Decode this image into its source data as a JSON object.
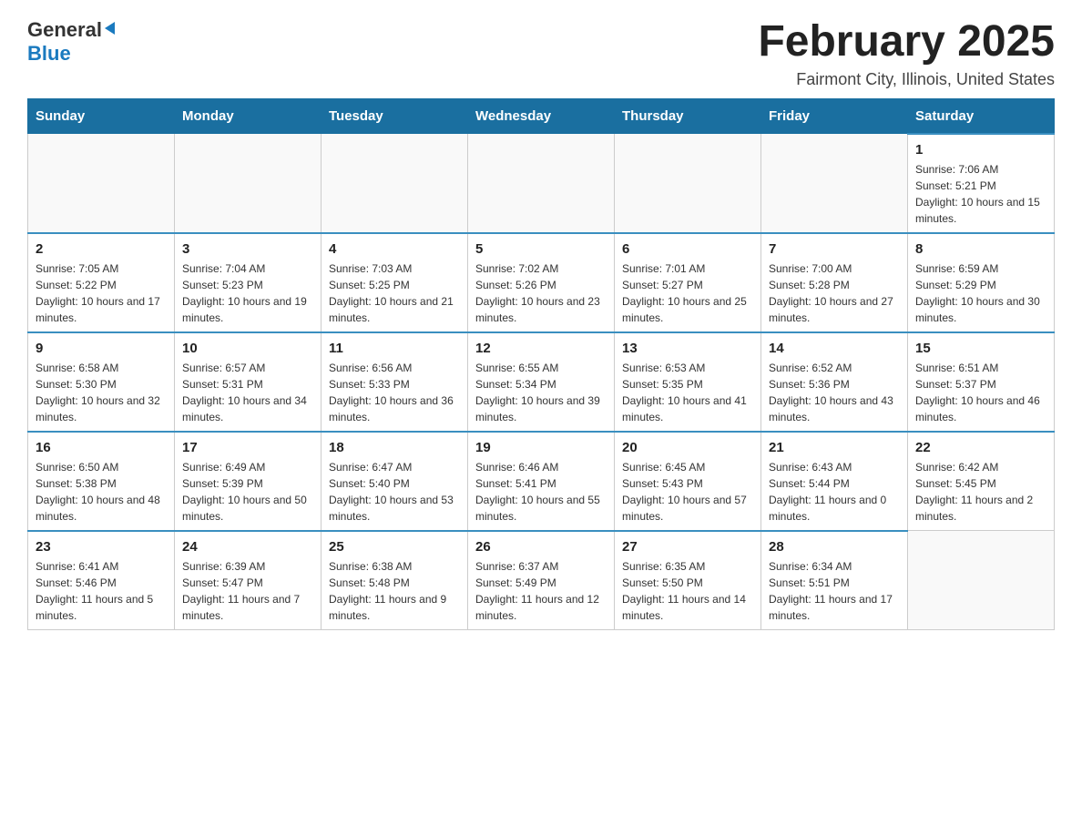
{
  "logo": {
    "general": "General",
    "blue": "Blue"
  },
  "title": {
    "month_year": "February 2025",
    "location": "Fairmont City, Illinois, United States"
  },
  "weekdays": [
    "Sunday",
    "Monday",
    "Tuesday",
    "Wednesday",
    "Thursday",
    "Friday",
    "Saturday"
  ],
  "weeks": [
    [
      {
        "day": "",
        "info": ""
      },
      {
        "day": "",
        "info": ""
      },
      {
        "day": "",
        "info": ""
      },
      {
        "day": "",
        "info": ""
      },
      {
        "day": "",
        "info": ""
      },
      {
        "day": "",
        "info": ""
      },
      {
        "day": "1",
        "info": "Sunrise: 7:06 AM\nSunset: 5:21 PM\nDaylight: 10 hours and 15 minutes."
      }
    ],
    [
      {
        "day": "2",
        "info": "Sunrise: 7:05 AM\nSunset: 5:22 PM\nDaylight: 10 hours and 17 minutes."
      },
      {
        "day": "3",
        "info": "Sunrise: 7:04 AM\nSunset: 5:23 PM\nDaylight: 10 hours and 19 minutes."
      },
      {
        "day": "4",
        "info": "Sunrise: 7:03 AM\nSunset: 5:25 PM\nDaylight: 10 hours and 21 minutes."
      },
      {
        "day": "5",
        "info": "Sunrise: 7:02 AM\nSunset: 5:26 PM\nDaylight: 10 hours and 23 minutes."
      },
      {
        "day": "6",
        "info": "Sunrise: 7:01 AM\nSunset: 5:27 PM\nDaylight: 10 hours and 25 minutes."
      },
      {
        "day": "7",
        "info": "Sunrise: 7:00 AM\nSunset: 5:28 PM\nDaylight: 10 hours and 27 minutes."
      },
      {
        "day": "8",
        "info": "Sunrise: 6:59 AM\nSunset: 5:29 PM\nDaylight: 10 hours and 30 minutes."
      }
    ],
    [
      {
        "day": "9",
        "info": "Sunrise: 6:58 AM\nSunset: 5:30 PM\nDaylight: 10 hours and 32 minutes."
      },
      {
        "day": "10",
        "info": "Sunrise: 6:57 AM\nSunset: 5:31 PM\nDaylight: 10 hours and 34 minutes."
      },
      {
        "day": "11",
        "info": "Sunrise: 6:56 AM\nSunset: 5:33 PM\nDaylight: 10 hours and 36 minutes."
      },
      {
        "day": "12",
        "info": "Sunrise: 6:55 AM\nSunset: 5:34 PM\nDaylight: 10 hours and 39 minutes."
      },
      {
        "day": "13",
        "info": "Sunrise: 6:53 AM\nSunset: 5:35 PM\nDaylight: 10 hours and 41 minutes."
      },
      {
        "day": "14",
        "info": "Sunrise: 6:52 AM\nSunset: 5:36 PM\nDaylight: 10 hours and 43 minutes."
      },
      {
        "day": "15",
        "info": "Sunrise: 6:51 AM\nSunset: 5:37 PM\nDaylight: 10 hours and 46 minutes."
      }
    ],
    [
      {
        "day": "16",
        "info": "Sunrise: 6:50 AM\nSunset: 5:38 PM\nDaylight: 10 hours and 48 minutes."
      },
      {
        "day": "17",
        "info": "Sunrise: 6:49 AM\nSunset: 5:39 PM\nDaylight: 10 hours and 50 minutes."
      },
      {
        "day": "18",
        "info": "Sunrise: 6:47 AM\nSunset: 5:40 PM\nDaylight: 10 hours and 53 minutes."
      },
      {
        "day": "19",
        "info": "Sunrise: 6:46 AM\nSunset: 5:41 PM\nDaylight: 10 hours and 55 minutes."
      },
      {
        "day": "20",
        "info": "Sunrise: 6:45 AM\nSunset: 5:43 PM\nDaylight: 10 hours and 57 minutes."
      },
      {
        "day": "21",
        "info": "Sunrise: 6:43 AM\nSunset: 5:44 PM\nDaylight: 11 hours and 0 minutes."
      },
      {
        "day": "22",
        "info": "Sunrise: 6:42 AM\nSunset: 5:45 PM\nDaylight: 11 hours and 2 minutes."
      }
    ],
    [
      {
        "day": "23",
        "info": "Sunrise: 6:41 AM\nSunset: 5:46 PM\nDaylight: 11 hours and 5 minutes."
      },
      {
        "day": "24",
        "info": "Sunrise: 6:39 AM\nSunset: 5:47 PM\nDaylight: 11 hours and 7 minutes."
      },
      {
        "day": "25",
        "info": "Sunrise: 6:38 AM\nSunset: 5:48 PM\nDaylight: 11 hours and 9 minutes."
      },
      {
        "day": "26",
        "info": "Sunrise: 6:37 AM\nSunset: 5:49 PM\nDaylight: 11 hours and 12 minutes."
      },
      {
        "day": "27",
        "info": "Sunrise: 6:35 AM\nSunset: 5:50 PM\nDaylight: 11 hours and 14 minutes."
      },
      {
        "day": "28",
        "info": "Sunrise: 6:34 AM\nSunset: 5:51 PM\nDaylight: 11 hours and 17 minutes."
      },
      {
        "day": "",
        "info": ""
      }
    ]
  ]
}
